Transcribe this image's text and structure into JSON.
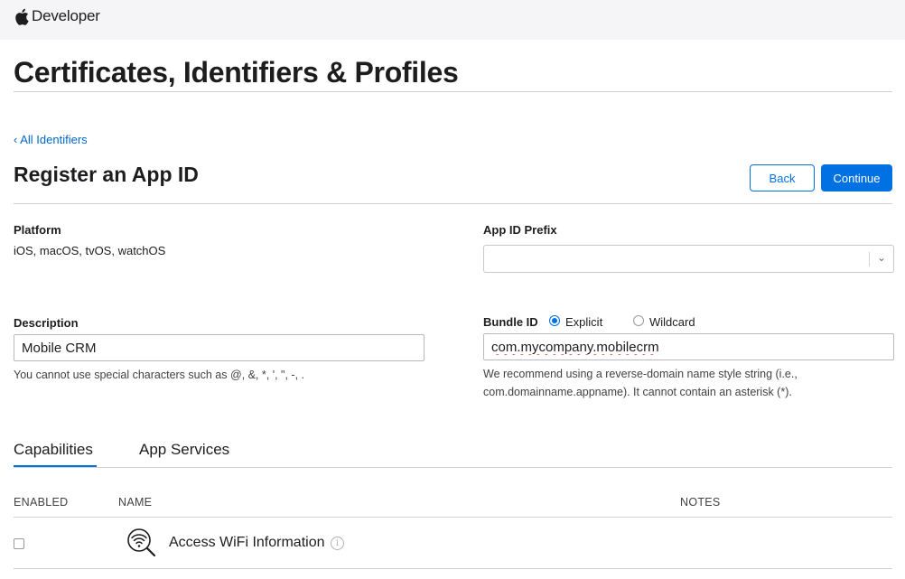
{
  "header": {
    "brand": "Developer"
  },
  "page": {
    "title": "Certificates, Identifiers & Profiles"
  },
  "nav": {
    "back_link": "‹ All Identifiers"
  },
  "form": {
    "title": "Register an App ID",
    "back_label": "Back",
    "continue_label": "Continue",
    "platform": {
      "label": "Platform",
      "value": "iOS, macOS, tvOS, watchOS"
    },
    "prefix": {
      "label": "App ID Prefix",
      "value": ""
    },
    "description": {
      "label": "Description",
      "value": "Mobile CRM",
      "hint": "You cannot use special characters such as @, &, *, ', \", -, ."
    },
    "bundle": {
      "label": "Bundle ID",
      "option_explicit": "Explicit",
      "option_wildcard": "Wildcard",
      "selected": "Explicit",
      "value": "com.mycompany.mobilecrm",
      "hint_line1": "We recommend using a reverse-domain name style string (i.e.,",
      "hint_line2": "com.domainname.appname). It cannot contain an asterisk (*)."
    }
  },
  "tabs": [
    {
      "label": "Capabilities",
      "active": true
    },
    {
      "label": "App Services",
      "active": false
    }
  ],
  "table": {
    "columns": {
      "enabled": "ENABLED",
      "name": "NAME",
      "notes": "NOTES"
    },
    "rows": [
      {
        "enabled": false,
        "name": "Access WiFi Information",
        "icon": "wifi-search-icon"
      }
    ]
  },
  "colors": {
    "accent": "#0071e3",
    "link": "#0066cc",
    "header_bg": "#f5f5f7",
    "spellcheck": "#e0443e"
  }
}
